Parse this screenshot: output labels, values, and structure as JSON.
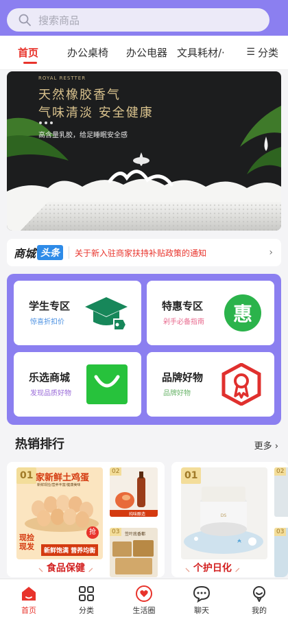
{
  "search": {
    "placeholder": "搜索商品"
  },
  "tabs": [
    {
      "label": "首页"
    },
    {
      "label": "办公桌椅"
    },
    {
      "label": "办公电器"
    },
    {
      "label": "文具耗材/·"
    }
  ],
  "category_button": {
    "icon": "menu-icon",
    "label": "分类"
  },
  "banner": {
    "brand": "ROYAL RESTTER",
    "line1": "天然橡胶香气",
    "line2": "气味清淡 安全健康",
    "line3": "高含量乳胶，给足睡眠安全感"
  },
  "news": {
    "logo_a": "商城",
    "logo_b": "头条",
    "text": "关于新入驻商家扶持补贴政策的通知"
  },
  "zones": [
    {
      "title": "学生专区",
      "subtitle": "惊喜折扣价",
      "subtitle_color": "#4a90e2",
      "icon": "graduation-cap-icon"
    },
    {
      "title": "特惠专区",
      "subtitle": "剁手必备指南",
      "subtitle_color": "#e86a8e",
      "icon": "discount-icon",
      "icon_char": "惠"
    },
    {
      "title": "乐选商城",
      "subtitle": "发现品质好物",
      "subtitle_color": "#9a6bd8",
      "icon": "shopping-bag-icon"
    },
    {
      "title": "品牌好物",
      "subtitle": "品牌好物",
      "subtitle_color": "#6bb56b",
      "icon": "award-badge-icon"
    }
  ],
  "hot": {
    "title": "热销排行",
    "more": "更多"
  },
  "cards": [
    {
      "category": "食品保健",
      "items": [
        {
          "rank": "01",
          "headline": "家新鲜土鸡蛋",
          "sub": "新鲜现捡/营养丰富/健康美味",
          "promo1": "现捡",
          "promo2": "现发",
          "slogan": "新鲜饱满 营养均衡",
          "badge": "抢"
        },
        {
          "rank": "02",
          "caption": "纯味酿造"
        },
        {
          "rank": "03",
          "caption": "笠叶底香都"
        }
      ]
    },
    {
      "category": "个护日化",
      "items": [
        {
          "rank": "01"
        },
        {
          "rank": "02"
        },
        {
          "rank": "03"
        }
      ]
    }
  ],
  "tabbar": [
    {
      "label": "首页",
      "icon": "home-icon"
    },
    {
      "label": "分类",
      "icon": "grid-icon"
    },
    {
      "label": "生活圈",
      "icon": "heart-chat-icon"
    },
    {
      "label": "聊天",
      "icon": "chat-icon"
    },
    {
      "label": "我的",
      "icon": "user-icon"
    }
  ],
  "colors": {
    "accent": "#e8332b",
    "header": "#8b7ff0",
    "gold": "#d9c28d"
  }
}
